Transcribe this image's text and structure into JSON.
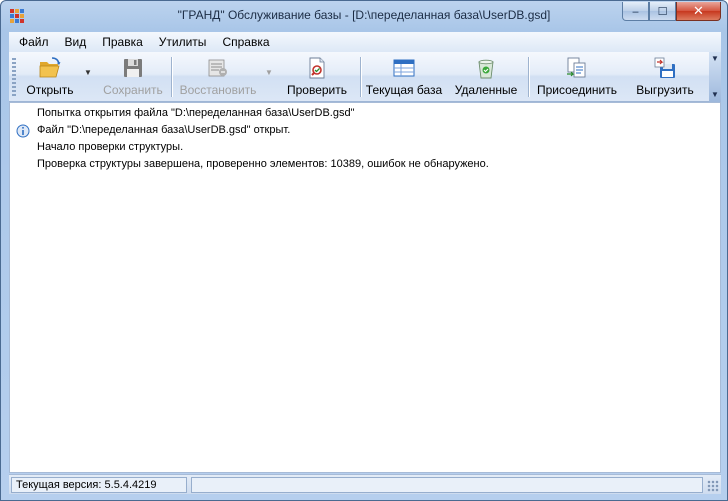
{
  "window": {
    "title": "\"ГРАНД\" Обслуживание базы - [D:\\переделанная база\\UserDB.gsd]",
    "minimize_symbol": "‒",
    "maximize_symbol": "☐",
    "close_symbol": "✕"
  },
  "menu": {
    "items": [
      "Файл",
      "Вид",
      "Правка",
      "Утилиты",
      "Справка"
    ]
  },
  "toolbar": {
    "open_label": "Открыть",
    "save_label": "Сохранить",
    "restore_label": "Восстановить",
    "check_label": "Проверить",
    "current_db_label": "Текущая база",
    "deleted_label": "Удаленные",
    "attach_label": "Присоединить",
    "export_label": "Выгрузить",
    "dropdown_glyph": "▼",
    "overflow_glyph": "▼"
  },
  "log": {
    "lines": [
      {
        "text": "Попытка открытия файла \"D:\\переделанная база\\UserDB.gsd\"",
        "icon": "none"
      },
      {
        "text": "Файл \"D:\\переделанная база\\UserDB.gsd\" открыт.",
        "icon": "info-icon"
      },
      {
        "text": "Начало проверки структуры.",
        "icon": "none"
      },
      {
        "text": "Проверка структуры завершена, проверенно элементов: 10389, ошибок не обнаружено.",
        "icon": "none"
      }
    ]
  },
  "status": {
    "version_label": "Текущая версия:",
    "version_value": "5.5.4.4219"
  },
  "colors": {
    "frame": "#a9c6e8",
    "accent_blue": "#2f6fc2",
    "close_red": "#c7381f",
    "folder_yellow": "#f2c24e"
  }
}
